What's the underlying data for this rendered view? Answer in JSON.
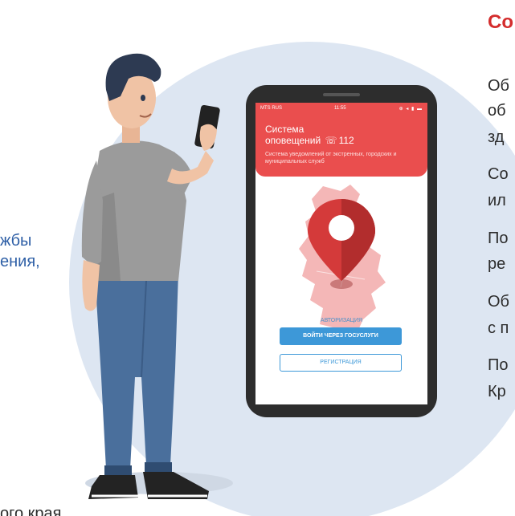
{
  "left_text": {
    "line1": "жбы",
    "line2": "ения,"
  },
  "bottom_left_text": "ого края",
  "right_column": {
    "title": "Со",
    "lines": [
      "Об",
      "об",
      "зд",
      "Со",
      "ил",
      "По",
      "ре",
      "Об",
      "с п",
      "По",
      "Кр"
    ]
  },
  "phone": {
    "status": {
      "carrier": "MTS RUS",
      "time": "11:55",
      "icons": "⊕ ◂ ▮ ▬"
    },
    "app": {
      "title_line1": "Система",
      "title_line2": "оповещений",
      "phone_icon": "phone-icon",
      "title_number": "112",
      "subtitle": "Система уведомлений от экстренных, городских и муниципальных служб"
    },
    "auth_label": "АВТОРИЗАЦИЯ",
    "gosuslugi_button": "ВОЙТИ ЧЕРЕЗ ГОСУСЛУГИ",
    "register_button": "РЕГИСТРАЦИЯ"
  },
  "colors": {
    "accent_red": "#ea4e4e",
    "title_red": "#d42d2d",
    "button_blue": "#3d98d8",
    "circle_bg": "#dde6f2",
    "left_text_blue": "#2e5fa6"
  }
}
